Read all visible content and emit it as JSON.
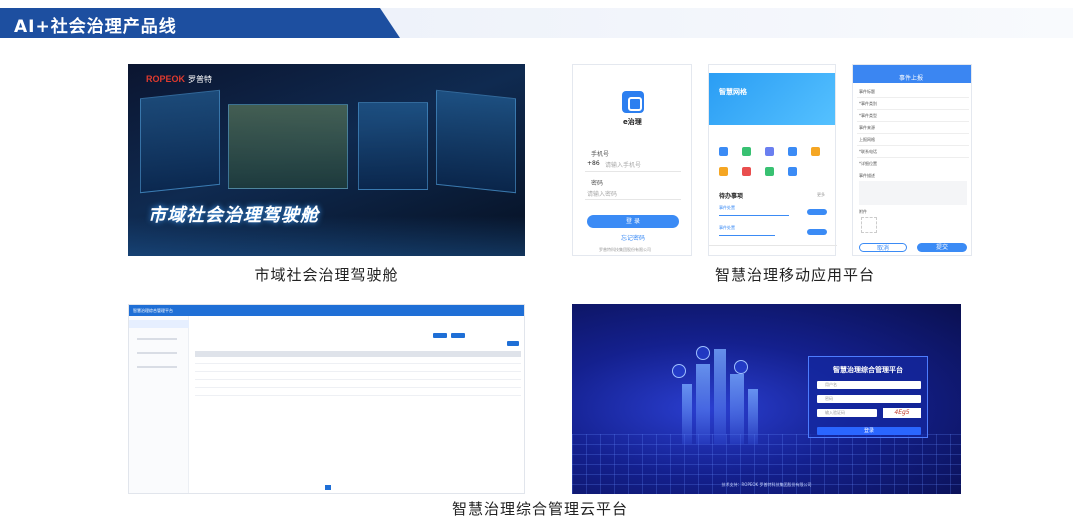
{
  "banner": {
    "title": "AI+社会治理产品线"
  },
  "cockpit": {
    "brand_en": "ROPEOK",
    "brand_cn": "罗普特",
    "title": "市域社会治理驾驶舱",
    "caption": "市域社会治理驾驶舱"
  },
  "mobile": {
    "caption": "智慧治理移动应用平台",
    "login": {
      "app_name": "e治理",
      "phone_label": "手机号",
      "country_code": "+86",
      "phone_placeholder": "请输入手机号",
      "password_label": "密码",
      "password_placeholder": "请输入密码",
      "login_button": "登 录",
      "forgot": "忘记密码",
      "footer": "罗普特科技集团股份有限公司"
    },
    "home": {
      "hero_title": "智慧网格",
      "todo_title": "待办事项",
      "event_label": "事件处置",
      "more": "更多"
    },
    "report": {
      "header": "事件上报",
      "fields": [
        "事件标题",
        "*事件类别",
        "*事件类型",
        "事件来源",
        "上报网格",
        "*联系电话",
        "*详细位置",
        "事件描述",
        "附件"
      ],
      "cancel": "取消",
      "submit": "提交"
    }
  },
  "admin": {
    "caption_unused": "",
    "app_title": "智慧治理综合管理平台"
  },
  "cloud": {
    "caption": "智慧治理综合管理云平台",
    "panel_title": "智慧治理综合管理平台",
    "user_placeholder": "用户名",
    "pass_placeholder": "密码",
    "captcha_placeholder": "输入验证码",
    "captcha": "4Eg5",
    "login": "登录",
    "footer": "技术支持：ROPEOK 罗普特科技集团股份有限公司"
  }
}
